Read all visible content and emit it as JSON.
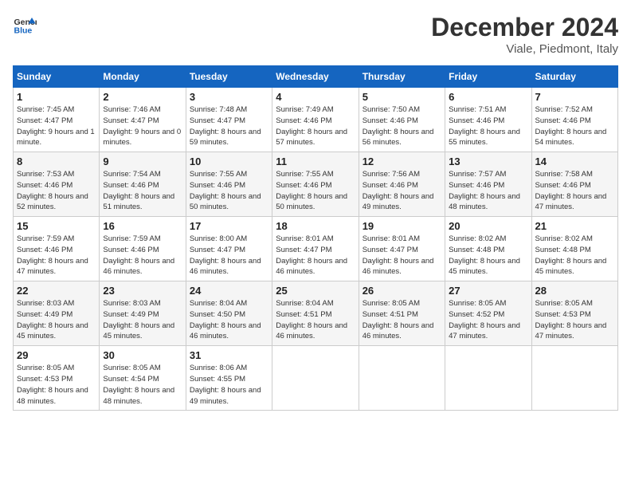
{
  "header": {
    "logo_line1": "General",
    "logo_line2": "Blue",
    "main_title": "December 2024",
    "subtitle": "Viale, Piedmont, Italy"
  },
  "weekdays": [
    "Sunday",
    "Monday",
    "Tuesday",
    "Wednesday",
    "Thursday",
    "Friday",
    "Saturday"
  ],
  "weeks": [
    [
      {
        "day": "1",
        "sunrise": "7:45 AM",
        "sunset": "4:47 PM",
        "daylight": "9 hours and 1 minute."
      },
      {
        "day": "2",
        "sunrise": "7:46 AM",
        "sunset": "4:47 PM",
        "daylight": "9 hours and 0 minutes."
      },
      {
        "day": "3",
        "sunrise": "7:48 AM",
        "sunset": "4:47 PM",
        "daylight": "8 hours and 59 minutes."
      },
      {
        "day": "4",
        "sunrise": "7:49 AM",
        "sunset": "4:46 PM",
        "daylight": "8 hours and 57 minutes."
      },
      {
        "day": "5",
        "sunrise": "7:50 AM",
        "sunset": "4:46 PM",
        "daylight": "8 hours and 56 minutes."
      },
      {
        "day": "6",
        "sunrise": "7:51 AM",
        "sunset": "4:46 PM",
        "daylight": "8 hours and 55 minutes."
      },
      {
        "day": "7",
        "sunrise": "7:52 AM",
        "sunset": "4:46 PM",
        "daylight": "8 hours and 54 minutes."
      }
    ],
    [
      {
        "day": "8",
        "sunrise": "7:53 AM",
        "sunset": "4:46 PM",
        "daylight": "8 hours and 52 minutes."
      },
      {
        "day": "9",
        "sunrise": "7:54 AM",
        "sunset": "4:46 PM",
        "daylight": "8 hours and 51 minutes."
      },
      {
        "day": "10",
        "sunrise": "7:55 AM",
        "sunset": "4:46 PM",
        "daylight": "8 hours and 50 minutes."
      },
      {
        "day": "11",
        "sunrise": "7:55 AM",
        "sunset": "4:46 PM",
        "daylight": "8 hours and 50 minutes."
      },
      {
        "day": "12",
        "sunrise": "7:56 AM",
        "sunset": "4:46 PM",
        "daylight": "8 hours and 49 minutes."
      },
      {
        "day": "13",
        "sunrise": "7:57 AM",
        "sunset": "4:46 PM",
        "daylight": "8 hours and 48 minutes."
      },
      {
        "day": "14",
        "sunrise": "7:58 AM",
        "sunset": "4:46 PM",
        "daylight": "8 hours and 47 minutes."
      }
    ],
    [
      {
        "day": "15",
        "sunrise": "7:59 AM",
        "sunset": "4:46 PM",
        "daylight": "8 hours and 47 minutes."
      },
      {
        "day": "16",
        "sunrise": "7:59 AM",
        "sunset": "4:46 PM",
        "daylight": "8 hours and 46 minutes."
      },
      {
        "day": "17",
        "sunrise": "8:00 AM",
        "sunset": "4:47 PM",
        "daylight": "8 hours and 46 minutes."
      },
      {
        "day": "18",
        "sunrise": "8:01 AM",
        "sunset": "4:47 PM",
        "daylight": "8 hours and 46 minutes."
      },
      {
        "day": "19",
        "sunrise": "8:01 AM",
        "sunset": "4:47 PM",
        "daylight": "8 hours and 46 minutes."
      },
      {
        "day": "20",
        "sunrise": "8:02 AM",
        "sunset": "4:48 PM",
        "daylight": "8 hours and 45 minutes."
      },
      {
        "day": "21",
        "sunrise": "8:02 AM",
        "sunset": "4:48 PM",
        "daylight": "8 hours and 45 minutes."
      }
    ],
    [
      {
        "day": "22",
        "sunrise": "8:03 AM",
        "sunset": "4:49 PM",
        "daylight": "8 hours and 45 minutes."
      },
      {
        "day": "23",
        "sunrise": "8:03 AM",
        "sunset": "4:49 PM",
        "daylight": "8 hours and 45 minutes."
      },
      {
        "day": "24",
        "sunrise": "8:04 AM",
        "sunset": "4:50 PM",
        "daylight": "8 hours and 46 minutes."
      },
      {
        "day": "25",
        "sunrise": "8:04 AM",
        "sunset": "4:51 PM",
        "daylight": "8 hours and 46 minutes."
      },
      {
        "day": "26",
        "sunrise": "8:05 AM",
        "sunset": "4:51 PM",
        "daylight": "8 hours and 46 minutes."
      },
      {
        "day": "27",
        "sunrise": "8:05 AM",
        "sunset": "4:52 PM",
        "daylight": "8 hours and 47 minutes."
      },
      {
        "day": "28",
        "sunrise": "8:05 AM",
        "sunset": "4:53 PM",
        "daylight": "8 hours and 47 minutes."
      }
    ],
    [
      {
        "day": "29",
        "sunrise": "8:05 AM",
        "sunset": "4:53 PM",
        "daylight": "8 hours and 48 minutes."
      },
      {
        "day": "30",
        "sunrise": "8:05 AM",
        "sunset": "4:54 PM",
        "daylight": "8 hours and 48 minutes."
      },
      {
        "day": "31",
        "sunrise": "8:06 AM",
        "sunset": "4:55 PM",
        "daylight": "8 hours and 49 minutes."
      },
      null,
      null,
      null,
      null
    ]
  ]
}
